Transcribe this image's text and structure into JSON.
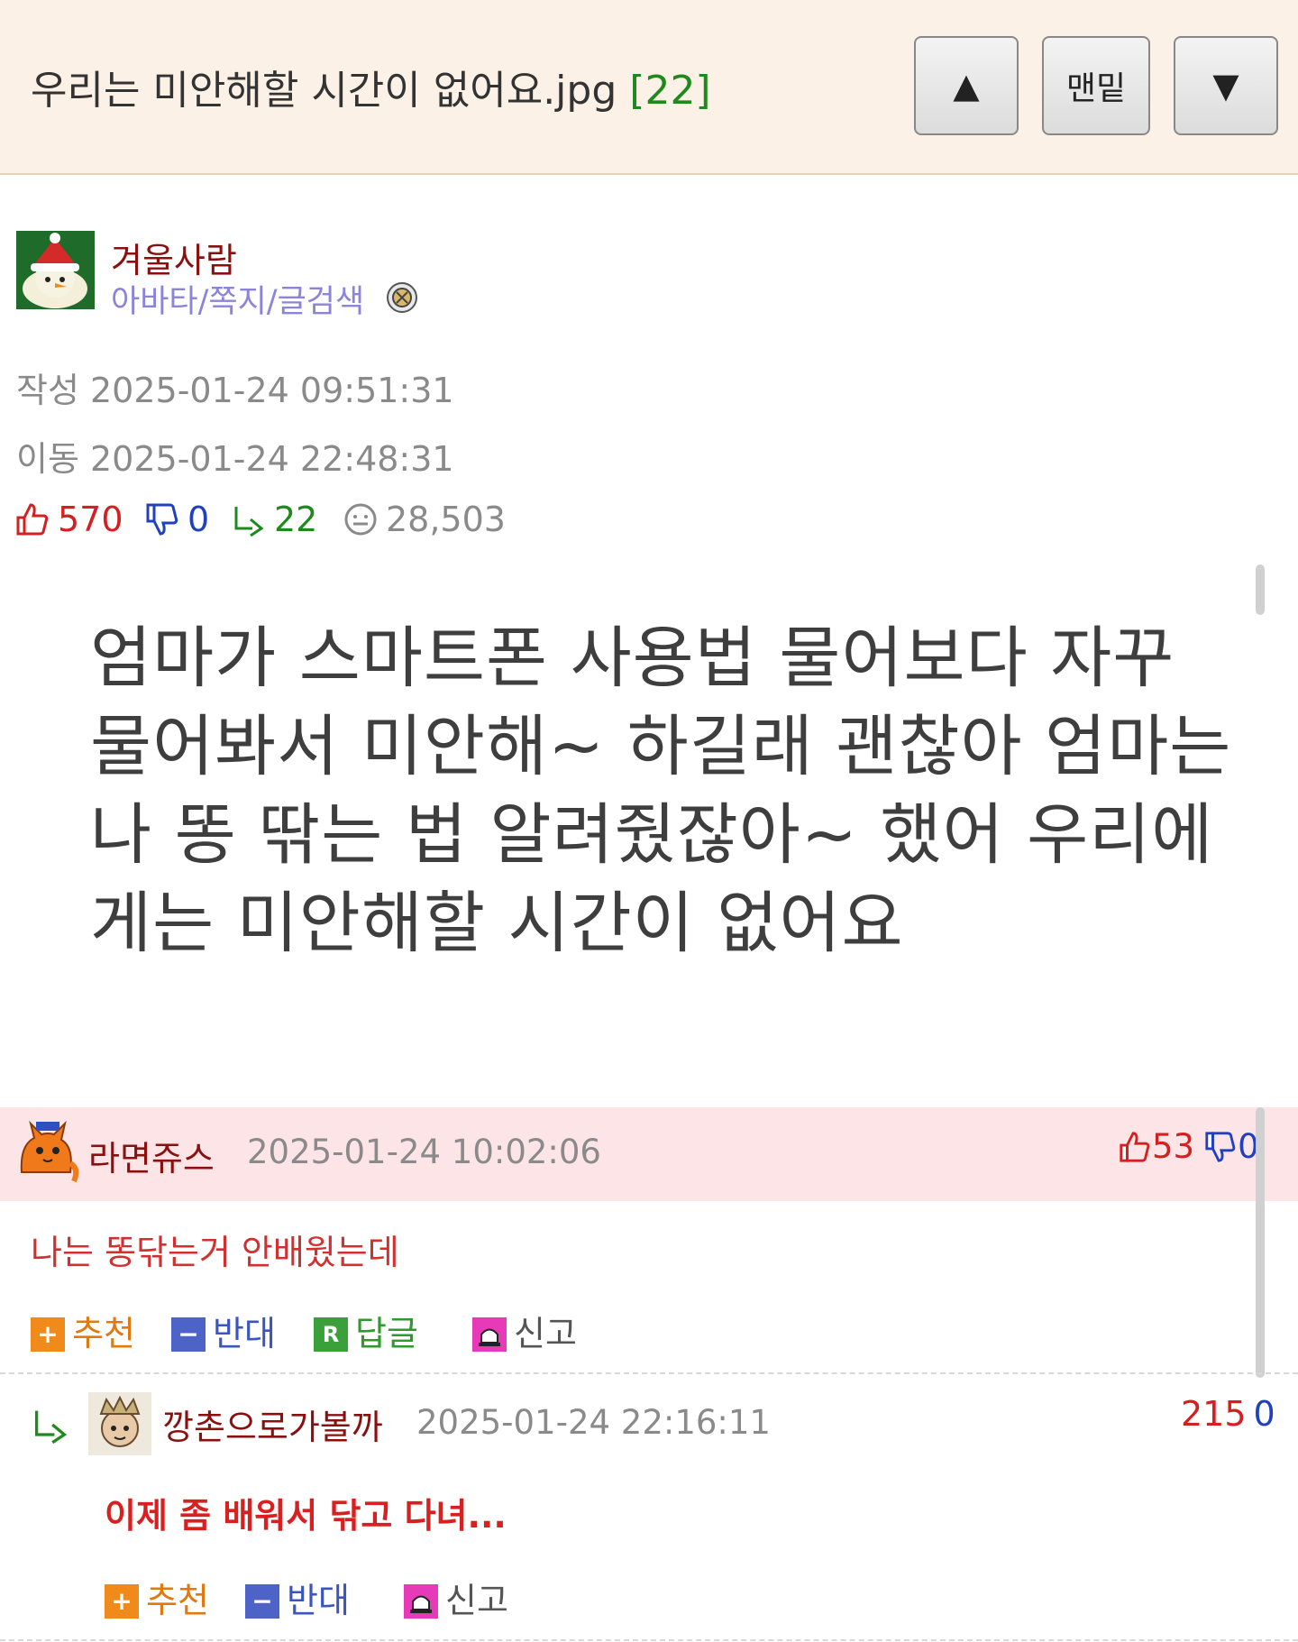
{
  "header": {
    "title": "우리는 미안해할 시간이 없어요.jpg",
    "comment_count": "[22]",
    "up_button": "▲",
    "bottom_button": "맨밑",
    "down_button": "▼"
  },
  "author": {
    "name": "겨울사람",
    "links": "아바타/쪽지/글검색",
    "avatar_icon": "snowman-santa-hat-avatar",
    "badge_icon": "level-badge-icon"
  },
  "meta": {
    "created": "작성 2025-01-24 09:51:31",
    "moved": "이동 2025-01-24 22:48:31"
  },
  "stats": {
    "likes": "570",
    "dislikes": "0",
    "replies": "22",
    "views": "28,503"
  },
  "content_image": {
    "lines": [
      "엄마가 스마트폰 사용법 물어보다 자꾸",
      "물어봐서 미안해~ 하길래 괜찮아 엄마는",
      "나 똥 딲는 법 알려줬잖아~ 했어 우리에",
      "게는 미안해할 시간이 없어요"
    ]
  },
  "comments": [
    {
      "name": "라면쥬스",
      "date": "2025-01-24 10:02:06",
      "up": "53",
      "down": "0",
      "text": "나는 똥닦는거 안배웠는데",
      "avatar_icon": "orange-cat-avatar",
      "actions": {
        "recommend": "추천",
        "oppose": "반대",
        "reply": "답글",
        "report": "신고",
        "reply_icon_letter": "R"
      }
    },
    {
      "name": "깡촌으로가볼까",
      "date": "2025-01-24 22:16:11",
      "up": "215",
      "down": "0",
      "text": "이제 좀 배워서 닦고 다녀...",
      "avatar_icon": "crowned-character-avatar",
      "actions": {
        "recommend": "추천",
        "oppose": "반대",
        "report": "신고"
      }
    }
  ],
  "colors": {
    "header_bg": "#fcf1e6",
    "comment_highlight_bg": "#fde4e6",
    "like_red": "#d32020",
    "dislike_blue": "#2040c0",
    "reply_green": "#1e8a1e",
    "author_name": "#8a1010",
    "links_purple": "#8b84d8"
  }
}
